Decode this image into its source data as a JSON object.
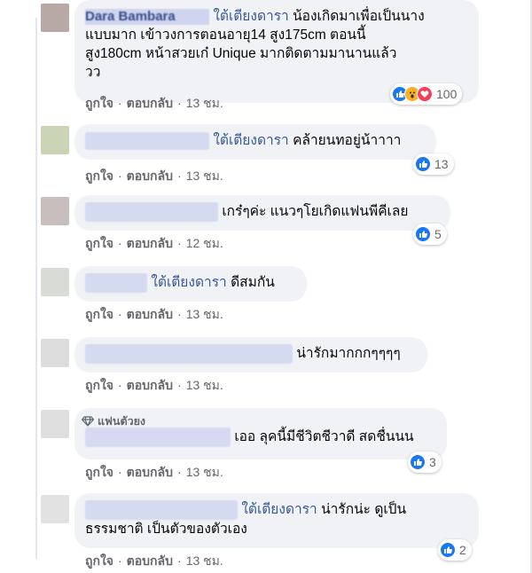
{
  "actions": {
    "like_label": "ถูกใจ",
    "reply_label": "ตอบกลับ",
    "separator": "·"
  },
  "comments": [
    {
      "author_visible": "Dara Bambara",
      "mention": "ใต้เตียงดารา",
      "text_lines": [
        "น้องเกิดมาเพื่อเป็นนาง",
        "แบบมาก เข้าวงการตอนอายุ14 สูง175cm ตอนนี้",
        "สูง180cm หน้าสวยเก๋ Unique มากติดตามมานานแล้ว",
        "วว"
      ],
      "time": "13 ชม.",
      "reactions": {
        "types": [
          "like-icon",
          "wow-icon",
          "love-icon"
        ],
        "count": "100"
      }
    },
    {
      "mention": "ใต้เตียงดารา",
      "text": "คล้ายนทอยู่น้าาาา",
      "time": "13 ชม.",
      "reactions": {
        "types": [
          "like-icon"
        ],
        "count": "13"
      }
    },
    {
      "text": "เกร๋ๆค่ะ แนวๆโยเกิดแฟนพีคีเลย",
      "time": "12 ชม.",
      "reactions": {
        "types": [
          "like-icon"
        ],
        "count": "5"
      }
    },
    {
      "mention": "ใต้เตียงดารา",
      "text": "ดีสมกัน",
      "time": "13 ชม."
    },
    {
      "text": "น่ารักมากกกๆๆๆๆ",
      "time": "13 ชม."
    },
    {
      "badge": "แฟนตัวยง",
      "text": "เออ ลุคนี้มีชีวิตชีวาดี สดชื่นนน",
      "time": "13 ชม.",
      "reactions": {
        "types": [
          "like-icon"
        ],
        "count": "3"
      }
    },
    {
      "mention": "ใต้เตียงดารา",
      "text_lines": [
        "น่ารักน่ะ ดูเป็น",
        "ธรรมชาติ เป็นตัวของตัวเอง"
      ],
      "time": "13 ชม.",
      "reactions": {
        "types": [
          "like-icon"
        ],
        "count": "2"
      }
    }
  ]
}
